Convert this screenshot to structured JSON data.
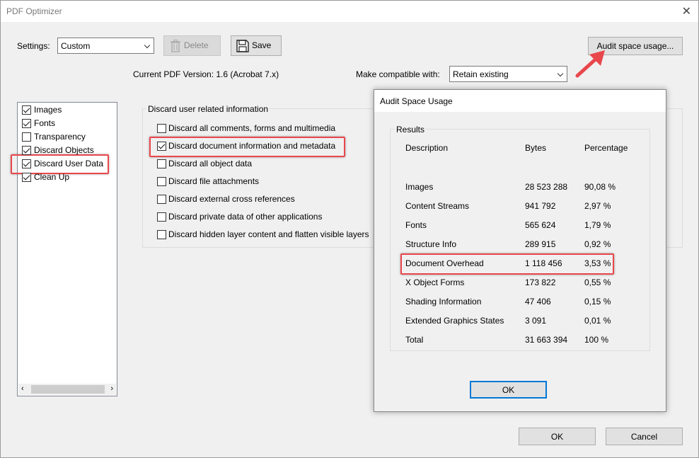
{
  "window": {
    "title": "PDF Optimizer",
    "close": "✕"
  },
  "settings": {
    "label": "Settings:",
    "value": "Custom",
    "delete_label": "Delete",
    "save_label": "Save",
    "audit_label": "Audit space usage...",
    "current_version": "Current PDF Version: 1.6 (Acrobat 7.x)",
    "compat_label": "Make compatible with:",
    "compat_value": "Retain existing"
  },
  "panels": [
    {
      "label": "Images",
      "checked": true
    },
    {
      "label": "Fonts",
      "checked": true
    },
    {
      "label": "Transparency",
      "checked": false
    },
    {
      "label": "Discard Objects",
      "checked": true
    },
    {
      "label": "Discard User Data",
      "checked": true
    },
    {
      "label": "Clean Up",
      "checked": true
    }
  ],
  "discard_group": {
    "title": "Discard user related information",
    "options": [
      {
        "label": "Discard all comments, forms and multimedia",
        "checked": false
      },
      {
        "label": "Discard document information and metadata",
        "checked": true
      },
      {
        "label": "Discard all object data",
        "checked": false
      },
      {
        "label": "Discard file attachments",
        "checked": false
      },
      {
        "label": "Discard external cross references",
        "checked": false
      },
      {
        "label": "Discard private data of other applications",
        "checked": false
      },
      {
        "label": "Discard hidden layer content and flatten visible layers",
        "checked": false
      }
    ]
  },
  "audit_dialog": {
    "title": "Audit Space Usage",
    "results_label": "Results",
    "headers": {
      "description": "Description",
      "bytes": "Bytes",
      "percentage": "Percentage"
    },
    "rows": [
      {
        "description": "Images",
        "bytes": "28 523 288",
        "percentage": "90,08 %"
      },
      {
        "description": "Content Streams",
        "bytes": "941 792",
        "percentage": "2,97 %"
      },
      {
        "description": "Fonts",
        "bytes": "565 624",
        "percentage": "1,79 %"
      },
      {
        "description": "Structure Info",
        "bytes": "289 915",
        "percentage": "0,92 %"
      },
      {
        "description": "Document Overhead",
        "bytes": "1 118 456",
        "percentage": "3,53 %"
      },
      {
        "description": "X Object Forms",
        "bytes": "173 822",
        "percentage": "0,55 %"
      },
      {
        "description": "Shading Information",
        "bytes": "47 406",
        "percentage": "0,15 %"
      },
      {
        "description": "Extended Graphics States",
        "bytes": "3 091",
        "percentage": "0,01 %"
      },
      {
        "description": "Total",
        "bytes": "31 663 394",
        "percentage": "100 %"
      }
    ],
    "ok_label": "OK"
  },
  "footer": {
    "ok_label": "OK",
    "cancel_label": "Cancel"
  },
  "colors": {
    "highlight": "#e8474c",
    "focus_border": "#0078d7",
    "button_face": "#e1e1e1"
  }
}
